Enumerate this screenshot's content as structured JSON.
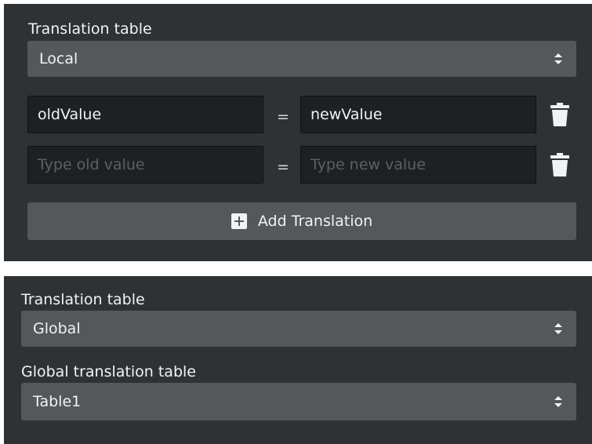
{
  "local_panel": {
    "table_label": "Translation table",
    "table_select": {
      "value": "Local"
    },
    "rows": [
      {
        "old_value": "oldValue",
        "old_placeholder": "Type old value",
        "equals": "=",
        "new_value": "newValue",
        "new_placeholder": "Type new value"
      },
      {
        "old_value": "",
        "old_placeholder": "Type old value",
        "equals": "=",
        "new_value": "",
        "new_placeholder": "Type new value"
      }
    ],
    "add_button_label": "Add Translation"
  },
  "global_panel": {
    "table_label": "Translation table",
    "table_select": {
      "value": "Global"
    },
    "global_table_label": "Global translation table",
    "global_table_select": {
      "value": "Table1"
    }
  },
  "icons": {
    "select_arrows": "up-down-arrows-icon",
    "delete": "trash-icon",
    "add": "plus-icon"
  },
  "colors": {
    "panel_bg": "#2f3234",
    "control_bg": "#54585b",
    "input_bg": "#1e2124",
    "text": "#f2f2f2",
    "placeholder": "#5b6064"
  }
}
